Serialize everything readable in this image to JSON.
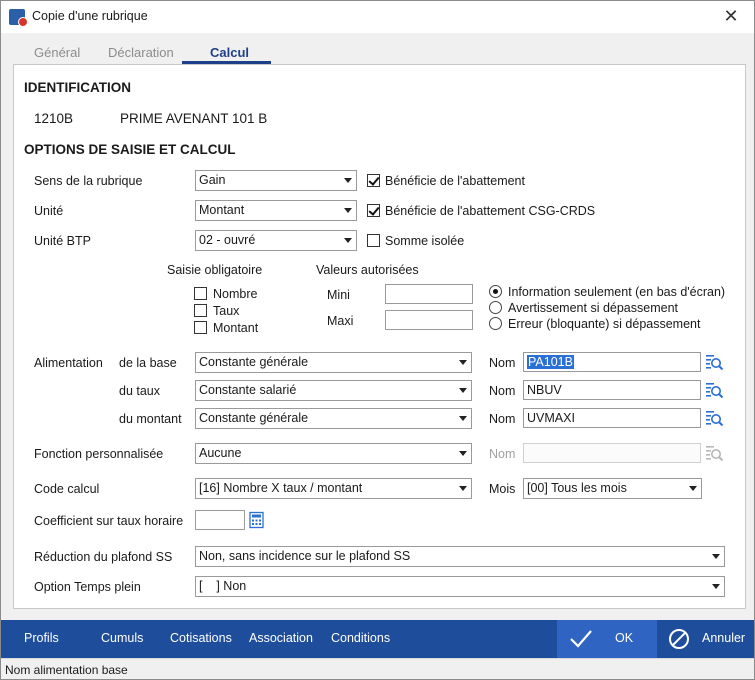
{
  "window": {
    "title": "Copie d'une rubrique",
    "close_label": "✕"
  },
  "tabs": [
    {
      "label": "Général"
    },
    {
      "label": "Déclaration"
    },
    {
      "label": "Calcul"
    }
  ],
  "identification": {
    "title": "IDENTIFICATION",
    "code": "1210B",
    "name": "PRIME AVENANT 101 B"
  },
  "options": {
    "title": "OPTIONS DE SAISIE ET CALCUL",
    "sens_label": "Sens de la rubrique",
    "sens_value": "Gain",
    "unite_label": "Unité",
    "unite_value": "Montant",
    "unite_btp_label": "Unité BTP",
    "unite_btp_value": "02 - ouvré",
    "abattement_label": "Bénéficie de l'abattement",
    "abattement_checked": true,
    "abattement_csg_label": "Bénéficie de l'abattement CSG-CRDS",
    "abattement_csg_checked": true,
    "somme_isolee_label": "Somme isolée",
    "somme_isolee_checked": false
  },
  "saisie": {
    "title": "Saisie obligatoire",
    "nombre": "Nombre",
    "taux": "Taux",
    "montant": "Montant"
  },
  "valeurs": {
    "title": "Valeurs autorisées",
    "mini_label": "Mini",
    "mini_value": "",
    "maxi_label": "Maxi",
    "maxi_value": "",
    "radio_info": "Information seulement (en bas d'écran)",
    "radio_avert": "Avertissement si dépassement",
    "radio_erreur": "Erreur (bloquante) si dépassement"
  },
  "alimentation": {
    "label": "Alimentation",
    "base_label": "de la base",
    "base_value": "Constante générale",
    "base_nom_label": "Nom",
    "base_nom_value": "PA101B",
    "taux_label": "du taux",
    "taux_value": "Constante salarié",
    "taux_nom_label": "Nom",
    "taux_nom_value": "NBUV",
    "montant_label": "du montant",
    "montant_value": "Constante générale",
    "montant_nom_label": "Nom",
    "montant_nom_value": "UVMAXI"
  },
  "fonction": {
    "label": "Fonction personnalisée",
    "value": "Aucune",
    "nom_label": "Nom",
    "nom_value": ""
  },
  "code_calcul": {
    "label": "Code calcul",
    "value": "[16]  Nombre X taux / montant",
    "mois_label": "Mois",
    "mois_value": "[00] Tous les mois"
  },
  "coefficient": {
    "label": "Coefficient sur taux horaire",
    "value": ""
  },
  "reduction": {
    "label": "Réduction du plafond SS",
    "value": "Non, sans incidence sur le plafond SS"
  },
  "temps_plein": {
    "label": "Option Temps plein",
    "value": "[    ] Non"
  },
  "bottom": {
    "profils": "Profils",
    "cumuls": "Cumuls",
    "cotisations": "Cotisations",
    "association": "Association",
    "conditions": "Conditions",
    "ok": "OK",
    "annuler": "Annuler"
  },
  "status": {
    "text": "Nom alimentation base"
  },
  "colors": {
    "bottom_bar": "#1e4d9c",
    "ok_bg": "#2f64c2",
    "tab_active": "#1e3f8a",
    "selection": "#2a6fd6"
  }
}
